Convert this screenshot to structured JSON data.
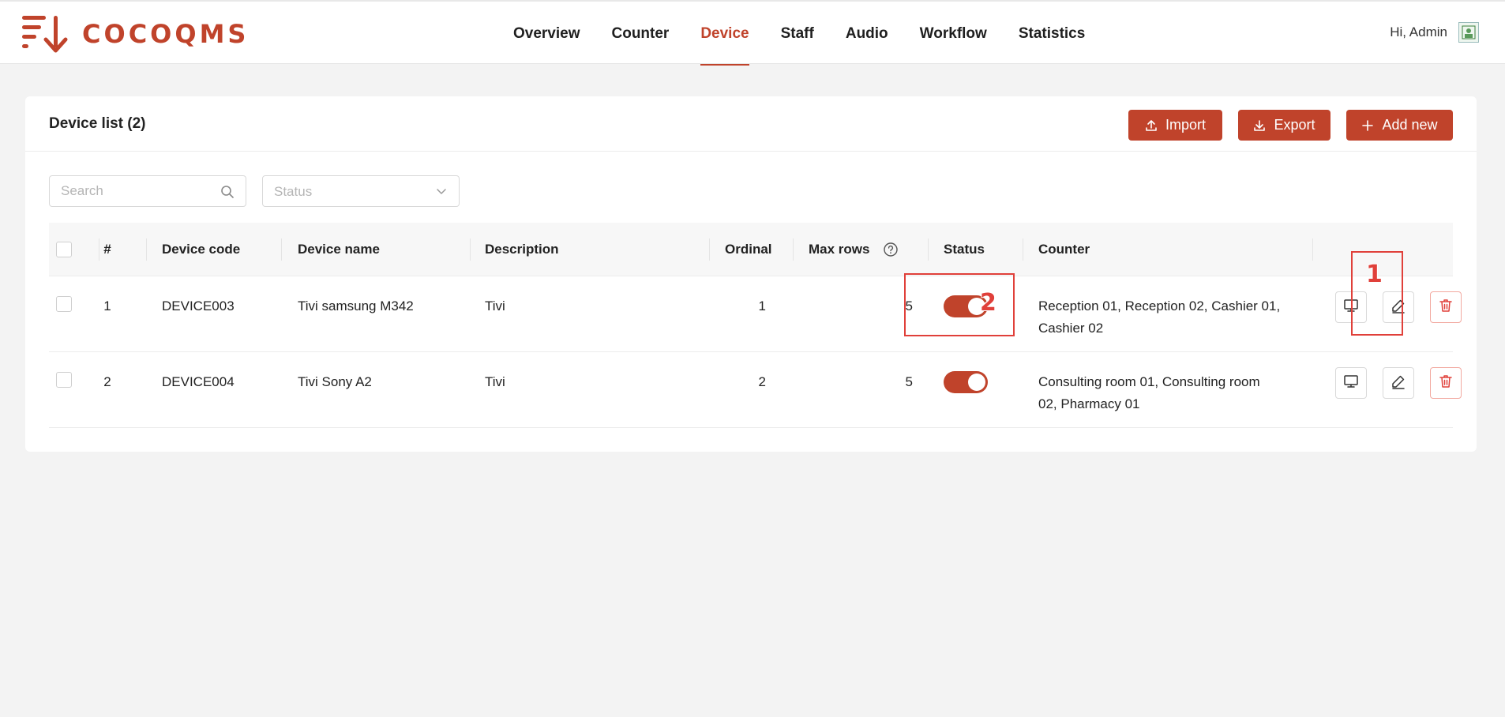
{
  "brand": {
    "name": "COCOQMS",
    "logo_icon": "cocoqms-logo-icon"
  },
  "nav": {
    "items": [
      {
        "label": "Overview"
      },
      {
        "label": "Counter"
      },
      {
        "label": "Device",
        "active": true
      },
      {
        "label": "Staff"
      },
      {
        "label": "Audio"
      },
      {
        "label": "Workflow"
      },
      {
        "label": "Statistics"
      }
    ]
  },
  "user": {
    "greeting": "Hi, Admin"
  },
  "card": {
    "title": "Device list (2)",
    "buttons": {
      "import": "Import",
      "export": "Export",
      "add": "Add new"
    }
  },
  "filters": {
    "search_placeholder": "Search",
    "status_placeholder": "Status"
  },
  "table": {
    "columns": [
      "#",
      "Device code",
      "Device name",
      "Description",
      "Ordinal",
      "Max rows",
      "Status",
      "Counter"
    ],
    "rows": [
      {
        "index": "1",
        "code": "DEVICE003",
        "name": "Tivi samsung M342",
        "description": "Tivi",
        "ordinal": "1",
        "max_rows": "5",
        "status_on": true,
        "counter_line1": "Reception 01, Reception 02, Cashier 01,",
        "counter_line2": "Cashier 02"
      },
      {
        "index": "2",
        "code": "DEVICE004",
        "name": "Tivi Sony A2",
        "description": "Tivi",
        "ordinal": "2",
        "max_rows": "5",
        "status_on": true,
        "counter_line1": "Consulting room 01, Consulting room",
        "counter_line2": "02, Pharmacy 01"
      }
    ]
  },
  "annotations": {
    "one": "1",
    "two": "2"
  },
  "colors": {
    "accent": "#c0432b",
    "annotation": "#e0403a"
  }
}
